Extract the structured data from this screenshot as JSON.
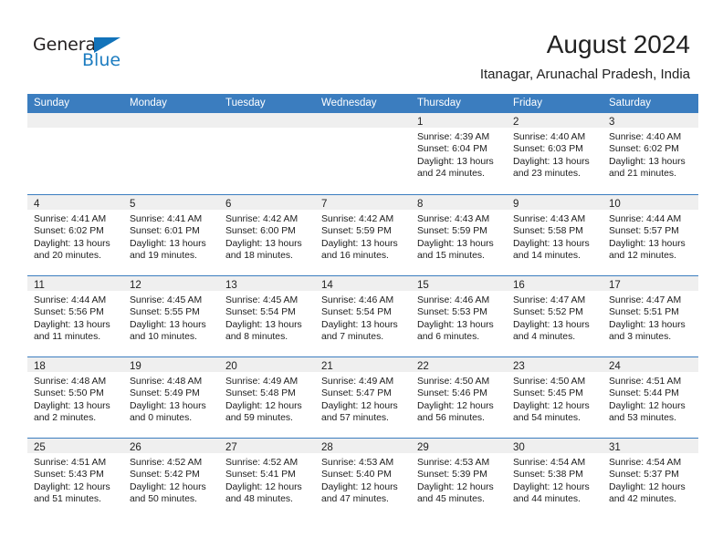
{
  "logo": {
    "word_top": "General",
    "word_bottom": "Blue",
    "triangle_color": "#1273ba"
  },
  "header": {
    "month_title": "August 2024",
    "location": "Itanagar, Arunachal Pradesh, India"
  },
  "theme": {
    "header_blue": "#3b7dbf",
    "daynum_band": "#efefef",
    "text": "#1c1c1c"
  },
  "weekday_headers": [
    "Sunday",
    "Monday",
    "Tuesday",
    "Wednesday",
    "Thursday",
    "Friday",
    "Saturday"
  ],
  "weeks": [
    [
      {
        "day": "",
        "lines": []
      },
      {
        "day": "",
        "lines": []
      },
      {
        "day": "",
        "lines": []
      },
      {
        "day": "",
        "lines": []
      },
      {
        "day": "1",
        "lines": [
          "Sunrise: 4:39 AM",
          "Sunset: 6:04 PM",
          "Daylight: 13 hours",
          "and 24 minutes."
        ]
      },
      {
        "day": "2",
        "lines": [
          "Sunrise: 4:40 AM",
          "Sunset: 6:03 PM",
          "Daylight: 13 hours",
          "and 23 minutes."
        ]
      },
      {
        "day": "3",
        "lines": [
          "Sunrise: 4:40 AM",
          "Sunset: 6:02 PM",
          "Daylight: 13 hours",
          "and 21 minutes."
        ]
      }
    ],
    [
      {
        "day": "4",
        "lines": [
          "Sunrise: 4:41 AM",
          "Sunset: 6:02 PM",
          "Daylight: 13 hours",
          "and 20 minutes."
        ]
      },
      {
        "day": "5",
        "lines": [
          "Sunrise: 4:41 AM",
          "Sunset: 6:01 PM",
          "Daylight: 13 hours",
          "and 19 minutes."
        ]
      },
      {
        "day": "6",
        "lines": [
          "Sunrise: 4:42 AM",
          "Sunset: 6:00 PM",
          "Daylight: 13 hours",
          "and 18 minutes."
        ]
      },
      {
        "day": "7",
        "lines": [
          "Sunrise: 4:42 AM",
          "Sunset: 5:59 PM",
          "Daylight: 13 hours",
          "and 16 minutes."
        ]
      },
      {
        "day": "8",
        "lines": [
          "Sunrise: 4:43 AM",
          "Sunset: 5:59 PM",
          "Daylight: 13 hours",
          "and 15 minutes."
        ]
      },
      {
        "day": "9",
        "lines": [
          "Sunrise: 4:43 AM",
          "Sunset: 5:58 PM",
          "Daylight: 13 hours",
          "and 14 minutes."
        ]
      },
      {
        "day": "10",
        "lines": [
          "Sunrise: 4:44 AM",
          "Sunset: 5:57 PM",
          "Daylight: 13 hours",
          "and 12 minutes."
        ]
      }
    ],
    [
      {
        "day": "11",
        "lines": [
          "Sunrise: 4:44 AM",
          "Sunset: 5:56 PM",
          "Daylight: 13 hours",
          "and 11 minutes."
        ]
      },
      {
        "day": "12",
        "lines": [
          "Sunrise: 4:45 AM",
          "Sunset: 5:55 PM",
          "Daylight: 13 hours",
          "and 10 minutes."
        ]
      },
      {
        "day": "13",
        "lines": [
          "Sunrise: 4:45 AM",
          "Sunset: 5:54 PM",
          "Daylight: 13 hours",
          "and 8 minutes."
        ]
      },
      {
        "day": "14",
        "lines": [
          "Sunrise: 4:46 AM",
          "Sunset: 5:54 PM",
          "Daylight: 13 hours",
          "and 7 minutes."
        ]
      },
      {
        "day": "15",
        "lines": [
          "Sunrise: 4:46 AM",
          "Sunset: 5:53 PM",
          "Daylight: 13 hours",
          "and 6 minutes."
        ]
      },
      {
        "day": "16",
        "lines": [
          "Sunrise: 4:47 AM",
          "Sunset: 5:52 PM",
          "Daylight: 13 hours",
          "and 4 minutes."
        ]
      },
      {
        "day": "17",
        "lines": [
          "Sunrise: 4:47 AM",
          "Sunset: 5:51 PM",
          "Daylight: 13 hours",
          "and 3 minutes."
        ]
      }
    ],
    [
      {
        "day": "18",
        "lines": [
          "Sunrise: 4:48 AM",
          "Sunset: 5:50 PM",
          "Daylight: 13 hours",
          "and 2 minutes."
        ]
      },
      {
        "day": "19",
        "lines": [
          "Sunrise: 4:48 AM",
          "Sunset: 5:49 PM",
          "Daylight: 13 hours",
          "and 0 minutes."
        ]
      },
      {
        "day": "20",
        "lines": [
          "Sunrise: 4:49 AM",
          "Sunset: 5:48 PM",
          "Daylight: 12 hours",
          "and 59 minutes."
        ]
      },
      {
        "day": "21",
        "lines": [
          "Sunrise: 4:49 AM",
          "Sunset: 5:47 PM",
          "Daylight: 12 hours",
          "and 57 minutes."
        ]
      },
      {
        "day": "22",
        "lines": [
          "Sunrise: 4:50 AM",
          "Sunset: 5:46 PM",
          "Daylight: 12 hours",
          "and 56 minutes."
        ]
      },
      {
        "day": "23",
        "lines": [
          "Sunrise: 4:50 AM",
          "Sunset: 5:45 PM",
          "Daylight: 12 hours",
          "and 54 minutes."
        ]
      },
      {
        "day": "24",
        "lines": [
          "Sunrise: 4:51 AM",
          "Sunset: 5:44 PM",
          "Daylight: 12 hours",
          "and 53 minutes."
        ]
      }
    ],
    [
      {
        "day": "25",
        "lines": [
          "Sunrise: 4:51 AM",
          "Sunset: 5:43 PM",
          "Daylight: 12 hours",
          "and 51 minutes."
        ]
      },
      {
        "day": "26",
        "lines": [
          "Sunrise: 4:52 AM",
          "Sunset: 5:42 PM",
          "Daylight: 12 hours",
          "and 50 minutes."
        ]
      },
      {
        "day": "27",
        "lines": [
          "Sunrise: 4:52 AM",
          "Sunset: 5:41 PM",
          "Daylight: 12 hours",
          "and 48 minutes."
        ]
      },
      {
        "day": "28",
        "lines": [
          "Sunrise: 4:53 AM",
          "Sunset: 5:40 PM",
          "Daylight: 12 hours",
          "and 47 minutes."
        ]
      },
      {
        "day": "29",
        "lines": [
          "Sunrise: 4:53 AM",
          "Sunset: 5:39 PM",
          "Daylight: 12 hours",
          "and 45 minutes."
        ]
      },
      {
        "day": "30",
        "lines": [
          "Sunrise: 4:54 AM",
          "Sunset: 5:38 PM",
          "Daylight: 12 hours",
          "and 44 minutes."
        ]
      },
      {
        "day": "31",
        "lines": [
          "Sunrise: 4:54 AM",
          "Sunset: 5:37 PM",
          "Daylight: 12 hours",
          "and 42 minutes."
        ]
      }
    ]
  ]
}
